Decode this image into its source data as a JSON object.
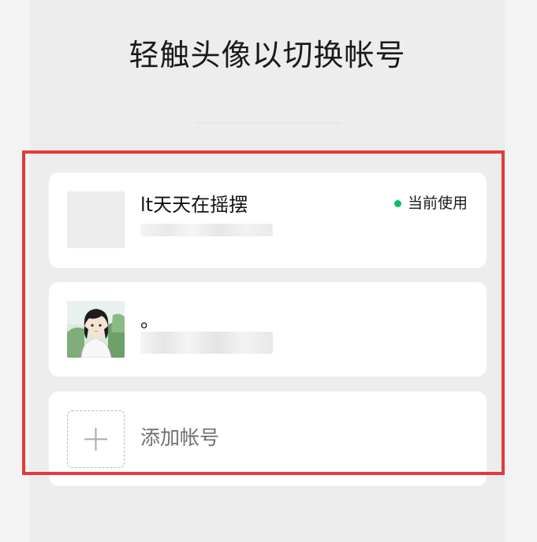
{
  "header": {
    "title": "轻触头像以切换帐号"
  },
  "accounts": [
    {
      "name": "lt天天在摇摆",
      "status": "当前使用",
      "status_color": "#07c160",
      "avatar_icon": "blank-avatar"
    },
    {
      "name": "。",
      "avatar_icon": "girl-portrait-avatar"
    }
  ],
  "add_account": {
    "label": "添加帐号",
    "icon": "plus-icon"
  },
  "highlight_color": "#e53a3a"
}
